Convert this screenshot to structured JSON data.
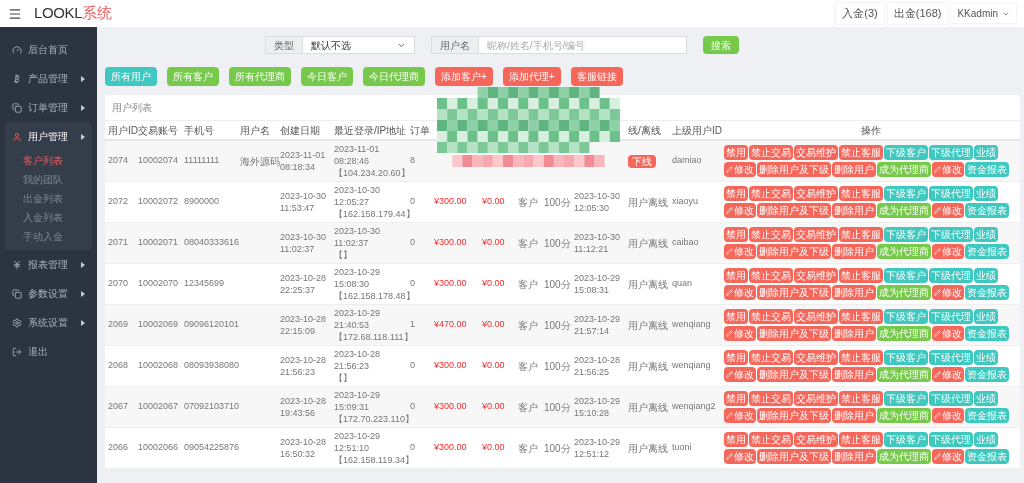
{
  "header": {
    "logo_main": "LOOKL",
    "logo_accent": "系统",
    "links": [
      "入金(3)",
      "出金(168)"
    ],
    "user": "KKadmin"
  },
  "sidebar": {
    "items": [
      {
        "label": "后台首页",
        "expandable": false,
        "expanded": false
      },
      {
        "label": "产品管理",
        "expandable": true,
        "expanded": false
      },
      {
        "label": "订单管理",
        "expandable": true,
        "expanded": false
      },
      {
        "label": "用户管理",
        "expandable": true,
        "expanded": true,
        "children": [
          {
            "label": "客户列表",
            "selected": true
          },
          {
            "label": "我的团队",
            "selected": false
          },
          {
            "label": "出金列表",
            "selected": false
          },
          {
            "label": "入金列表",
            "selected": false
          },
          {
            "label": "手动入金",
            "selected": false
          }
        ]
      },
      {
        "label": "报表管理",
        "expandable": true,
        "expanded": false
      },
      {
        "label": "参数设置",
        "expandable": true,
        "expanded": false
      },
      {
        "label": "系统设置",
        "expandable": true,
        "expanded": false
      },
      {
        "label": "退出",
        "expandable": false,
        "expanded": false
      }
    ]
  },
  "filters": {
    "type_label": "类型",
    "type_value": "默认不选",
    "name_label": "用户名",
    "name_placeholder": "昵称/姓名/手机号/编号",
    "search": "搜索"
  },
  "quick_buttons": [
    {
      "label": "所有用户",
      "color": "#3ec8bf"
    },
    {
      "label": "所有客户",
      "color": "#77c94b"
    },
    {
      "label": "所有代理商",
      "color": "#77c94b"
    },
    {
      "label": "今日客户",
      "color": "#77c94b"
    },
    {
      "label": "今日代理商",
      "color": "#77c94b"
    },
    {
      "label": "添加客户+",
      "color": "#f6675b"
    },
    {
      "label": "添加代理+",
      "color": "#f6675b"
    },
    {
      "label": "客服链接",
      "color": "#f6675b"
    }
  ],
  "table": {
    "title": "用户列表",
    "columns": [
      "用户ID",
      "交易账号",
      "手机号",
      "用户名",
      "创建日期",
      "最近登录/IP地址",
      "订单"
    ],
    "columns_right": [
      "线/离线",
      "上级用户ID",
      "操作"
    ],
    "rows": [
      {
        "id": "2074",
        "account": "10002074",
        "phone": "11111111",
        "username": "海外源码",
        "created": [
          "2023-11-01",
          "08:18:34"
        ],
        "login": [
          "2023-11-01",
          "08:28:46",
          "【104.234.20.60】"
        ],
        "orders": "8",
        "status": "下线",
        "status_highlighted": true,
        "parent": "damiao",
        "actions": [
          {
            "label": "禁用",
            "color": "#f6675b",
            "kind": "plain"
          },
          {
            "label": "禁止交易",
            "color": "#f6675b",
            "kind": "plain"
          },
          {
            "label": "交易维护",
            "color": "#f6675b",
            "kind": "plain"
          },
          {
            "label": "禁止客服",
            "color": "#f6675b",
            "kind": "plain"
          },
          {
            "label": "下级客户",
            "color": "#3ec8bf",
            "kind": "plain"
          },
          {
            "label": "下级代理",
            "color": "#3ec8bf",
            "kind": "plain"
          },
          {
            "label": "业绩",
            "color": "#3ec8bf",
            "kind": "plain"
          },
          {
            "label": "修改",
            "color": "#f6675b",
            "kind": "edit"
          },
          {
            "label": "删除用户及下级",
            "color": "#f6675b",
            "kind": "plain"
          },
          {
            "label": "删除用户",
            "color": "#f6675b",
            "kind": "plain"
          },
          {
            "label": "成为代理商",
            "color": "#77c94b",
            "kind": "plain"
          },
          {
            "label": "修改",
            "color": "#f6675b",
            "kind": "edit"
          },
          {
            "label": "资金报表",
            "color": "#3ec8bf",
            "kind": "plain"
          }
        ]
      },
      {
        "id": "2072",
        "account": "10002072",
        "phone": "8900000",
        "created": [
          "2023-10-30",
          "11:53:47"
        ],
        "login": [
          "2023-10-30",
          "12:05:27",
          "【162.158.179.44】"
        ],
        "orders": "0",
        "amount": "¥300.00",
        "balance": "¥0.00",
        "type": "客户",
        "score": "100分",
        "time": [
          "2023-10-30",
          "12:05:30"
        ],
        "status": "用户离线",
        "status_highlighted": false,
        "parent": "xiaoyu",
        "actions": [
          {
            "label": "禁用",
            "color": "#f6675b",
            "kind": "plain"
          },
          {
            "label": "禁止交易",
            "color": "#f6675b",
            "kind": "plain"
          },
          {
            "label": "交易维护",
            "color": "#f6675b",
            "kind": "plain"
          },
          {
            "label": "禁止客服",
            "color": "#f6675b",
            "kind": "plain"
          },
          {
            "label": "下级客户",
            "color": "#3ec8bf",
            "kind": "plain"
          },
          {
            "label": "下级代理",
            "color": "#3ec8bf",
            "kind": "plain"
          },
          {
            "label": "业绩",
            "color": "#3ec8bf",
            "kind": "plain"
          },
          {
            "label": "修改",
            "color": "#f6675b",
            "kind": "edit"
          },
          {
            "label": "删除用户及下级",
            "color": "#f6675b",
            "kind": "plain"
          },
          {
            "label": "删除用户",
            "color": "#f6675b",
            "kind": "plain"
          },
          {
            "label": "成为代理商",
            "color": "#77c94b",
            "kind": "plain"
          },
          {
            "label": "修改",
            "color": "#f6675b",
            "kind": "edit"
          },
          {
            "label": "资金报表",
            "color": "#3ec8bf",
            "kind": "plain"
          }
        ]
      },
      {
        "id": "2071",
        "account": "10002071",
        "phone": "08040333616",
        "created": [
          "2023-10-30",
          "11:02:37"
        ],
        "login": [
          "2023-10-30",
          "11:02:37",
          "【】"
        ],
        "orders": "0",
        "amount": "¥300.00",
        "balance": "¥0.00",
        "type": "客户",
        "score": "100分",
        "time": [
          "2023-10-30",
          "11:12:21"
        ],
        "status": "用户离线",
        "status_highlighted": false,
        "parent": "caibao",
        "actions": [
          {
            "label": "禁用",
            "color": "#f6675b",
            "kind": "plain"
          },
          {
            "label": "禁止交易",
            "color": "#f6675b",
            "kind": "plain"
          },
          {
            "label": "交易维护",
            "color": "#f6675b",
            "kind": "plain"
          },
          {
            "label": "禁止客服",
            "color": "#f6675b",
            "kind": "plain"
          },
          {
            "label": "下级客户",
            "color": "#3ec8bf",
            "kind": "plain"
          },
          {
            "label": "下级代理",
            "color": "#3ec8bf",
            "kind": "plain"
          },
          {
            "label": "业绩",
            "color": "#3ec8bf",
            "kind": "plain"
          },
          {
            "label": "修改",
            "color": "#f6675b",
            "kind": "edit"
          },
          {
            "label": "删除用户及下级",
            "color": "#f6675b",
            "kind": "plain"
          },
          {
            "label": "删除用户",
            "color": "#f6675b",
            "kind": "plain"
          },
          {
            "label": "成为代理商",
            "color": "#77c94b",
            "kind": "plain"
          },
          {
            "label": "修改",
            "color": "#f6675b",
            "kind": "edit"
          },
          {
            "label": "资金报表",
            "color": "#3ec8bf",
            "kind": "plain"
          }
        ]
      },
      {
        "id": "2070",
        "account": "10002070",
        "phone": "12345699",
        "created": [
          "2023-10-28",
          "22:25:37"
        ],
        "login": [
          "2023-10-29",
          "15:08:30",
          "【162.158.178.48】"
        ],
        "orders": "0",
        "amount": "¥300.00",
        "balance": "¥0.00",
        "type": "客户",
        "score": "100分",
        "time": [
          "2023-10-29",
          "15:08:31"
        ],
        "status": "用户离线",
        "status_highlighted": false,
        "parent": "quan",
        "actions": [
          {
            "label": "禁用",
            "color": "#f6675b",
            "kind": "plain"
          },
          {
            "label": "禁止交易",
            "color": "#f6675b",
            "kind": "plain"
          },
          {
            "label": "交易维护",
            "color": "#f6675b",
            "kind": "plain"
          },
          {
            "label": "禁止客服",
            "color": "#f6675b",
            "kind": "plain"
          },
          {
            "label": "下级客户",
            "color": "#3ec8bf",
            "kind": "plain"
          },
          {
            "label": "下级代理",
            "color": "#3ec8bf",
            "kind": "plain"
          },
          {
            "label": "业绩",
            "color": "#3ec8bf",
            "kind": "plain"
          },
          {
            "label": "修改",
            "color": "#f6675b",
            "kind": "edit"
          },
          {
            "label": "删除用户及下级",
            "color": "#f6675b",
            "kind": "plain"
          },
          {
            "label": "删除用户",
            "color": "#f6675b",
            "kind": "plain"
          },
          {
            "label": "成为代理商",
            "color": "#77c94b",
            "kind": "plain"
          },
          {
            "label": "修改",
            "color": "#f6675b",
            "kind": "edit"
          },
          {
            "label": "资金报表",
            "color": "#3ec8bf",
            "kind": "plain"
          }
        ]
      },
      {
        "id": "2069",
        "account": "10002069",
        "phone": "09096120101",
        "created": [
          "2023-10-28",
          "22:15:09"
        ],
        "login": [
          "2023-10-29",
          "21:40:53",
          "【172.68.118.111】"
        ],
        "orders": "1",
        "amount": "¥470.00",
        "balance": "¥0.00",
        "type": "客户",
        "score": "100分",
        "time": [
          "2023-10-29",
          "21:57:14"
        ],
        "status": "用户离线",
        "status_highlighted": false,
        "parent": "wenqiang",
        "actions": [
          {
            "label": "禁用",
            "color": "#f6675b",
            "kind": "plain"
          },
          {
            "label": "禁止交易",
            "color": "#f6675b",
            "kind": "plain"
          },
          {
            "label": "交易维护",
            "color": "#f6675b",
            "kind": "plain"
          },
          {
            "label": "禁止客服",
            "color": "#f6675b",
            "kind": "plain"
          },
          {
            "label": "下级客户",
            "color": "#3ec8bf",
            "kind": "plain"
          },
          {
            "label": "下级代理",
            "color": "#3ec8bf",
            "kind": "plain"
          },
          {
            "label": "业绩",
            "color": "#3ec8bf",
            "kind": "plain"
          },
          {
            "label": "修改",
            "color": "#f6675b",
            "kind": "edit"
          },
          {
            "label": "删除用户及下级",
            "color": "#f6675b",
            "kind": "plain"
          },
          {
            "label": "删除用户",
            "color": "#f6675b",
            "kind": "plain"
          },
          {
            "label": "成为代理商",
            "color": "#77c94b",
            "kind": "plain"
          },
          {
            "label": "修改",
            "color": "#f6675b",
            "kind": "edit"
          },
          {
            "label": "资金报表",
            "color": "#3ec8bf",
            "kind": "plain"
          }
        ]
      },
      {
        "id": "2068",
        "account": "10002068",
        "phone": "08093938080",
        "created": [
          "2023-10-28",
          "21:56:23"
        ],
        "login": [
          "2023-10-28",
          "21:56:23",
          "【】"
        ],
        "orders": "0",
        "amount": "¥300.00",
        "balance": "¥0.00",
        "type": "客户",
        "score": "100分",
        "time": [
          "2023-10-28",
          "21:56:25"
        ],
        "status": "用户离线",
        "status_highlighted": false,
        "parent": "wenqiang",
        "actions": [
          {
            "label": "禁用",
            "color": "#f6675b",
            "kind": "plain"
          },
          {
            "label": "禁止交易",
            "color": "#f6675b",
            "kind": "plain"
          },
          {
            "label": "交易维护",
            "color": "#f6675b",
            "kind": "plain"
          },
          {
            "label": "禁止客服",
            "color": "#f6675b",
            "kind": "plain"
          },
          {
            "label": "下级客户",
            "color": "#3ec8bf",
            "kind": "plain"
          },
          {
            "label": "下级代理",
            "color": "#3ec8bf",
            "kind": "plain"
          },
          {
            "label": "业绩",
            "color": "#3ec8bf",
            "kind": "plain"
          },
          {
            "label": "修改",
            "color": "#f6675b",
            "kind": "edit"
          },
          {
            "label": "删除用户及下级",
            "color": "#f6675b",
            "kind": "plain"
          },
          {
            "label": "删除用户",
            "color": "#f6675b",
            "kind": "plain"
          },
          {
            "label": "成为代理商",
            "color": "#77c94b",
            "kind": "plain"
          },
          {
            "label": "修改",
            "color": "#f6675b",
            "kind": "edit"
          },
          {
            "label": "资金报表",
            "color": "#3ec8bf",
            "kind": "plain"
          }
        ]
      },
      {
        "id": "2067",
        "account": "10002067",
        "phone": "07092103710",
        "created": [
          "2023-10-28",
          "19:43:56"
        ],
        "login": [
          "2023-10-29",
          "15:09:31",
          "【172.70.223.110】"
        ],
        "orders": "0",
        "amount": "¥300.00",
        "balance": "¥0.00",
        "type": "客户",
        "score": "100分",
        "time": [
          "2023-10-29",
          "15:10:28"
        ],
        "status": "用户离线",
        "status_highlighted": false,
        "parent": "wenqiang2",
        "actions": [
          {
            "label": "禁用",
            "color": "#f6675b",
            "kind": "plain"
          },
          {
            "label": "禁止交易",
            "color": "#f6675b",
            "kind": "plain"
          },
          {
            "label": "交易维护",
            "color": "#f6675b",
            "kind": "plain"
          },
          {
            "label": "禁止客服",
            "color": "#f6675b",
            "kind": "plain"
          },
          {
            "label": "下级客户",
            "color": "#3ec8bf",
            "kind": "plain"
          },
          {
            "label": "下级代理",
            "color": "#3ec8bf",
            "kind": "plain"
          },
          {
            "label": "业绩",
            "color": "#3ec8bf",
            "kind": "plain"
          },
          {
            "label": "修改",
            "color": "#f6675b",
            "kind": "edit"
          },
          {
            "label": "删除用户及下级",
            "color": "#f6675b",
            "kind": "plain"
          },
          {
            "label": "删除用户",
            "color": "#f6675b",
            "kind": "plain"
          },
          {
            "label": "成为代理商",
            "color": "#77c94b",
            "kind": "plain"
          },
          {
            "label": "修改",
            "color": "#f6675b",
            "kind": "edit"
          },
          {
            "label": "资金报表",
            "color": "#3ec8bf",
            "kind": "plain"
          }
        ]
      },
      {
        "id": "2066",
        "account": "10002066",
        "phone": "09054225876",
        "created": [
          "2023-10-28",
          "16:50:32"
        ],
        "login": [
          "2023-10-29",
          "12:51:10",
          "【162.158.119.34】"
        ],
        "orders": "0",
        "amount": "¥300.00",
        "balance": "¥0.00",
        "type": "客户",
        "score": "100分",
        "time": [
          "2023-10-29",
          "12:51:12"
        ],
        "status": "用户离线",
        "status_highlighted": false,
        "parent": "tuoni",
        "actions": [
          {
            "label": "禁用",
            "color": "#f6675b",
            "kind": "plain"
          },
          {
            "label": "禁止交易",
            "color": "#f6675b",
            "kind": "plain"
          },
          {
            "label": "交易维护",
            "color": "#f6675b",
            "kind": "plain"
          },
          {
            "label": "禁止客服",
            "color": "#f6675b",
            "kind": "plain"
          },
          {
            "label": "下级客户",
            "color": "#3ec8bf",
            "kind": "plain"
          },
          {
            "label": "下级代理",
            "color": "#3ec8bf",
            "kind": "plain"
          },
          {
            "label": "业绩",
            "color": "#3ec8bf",
            "kind": "plain"
          },
          {
            "label": "修改",
            "color": "#f6675b",
            "kind": "edit"
          },
          {
            "label": "删除用户及下级",
            "color": "#f6675b",
            "kind": "plain"
          },
          {
            "label": "删除用户",
            "color": "#f6675b",
            "kind": "plain"
          },
          {
            "label": "成为代理商",
            "color": "#77c94b",
            "kind": "plain"
          },
          {
            "label": "修改",
            "color": "#f6675b",
            "kind": "edit"
          },
          {
            "label": "资金报表",
            "color": "#3ec8bf",
            "kind": "plain"
          }
        ]
      }
    ]
  }
}
